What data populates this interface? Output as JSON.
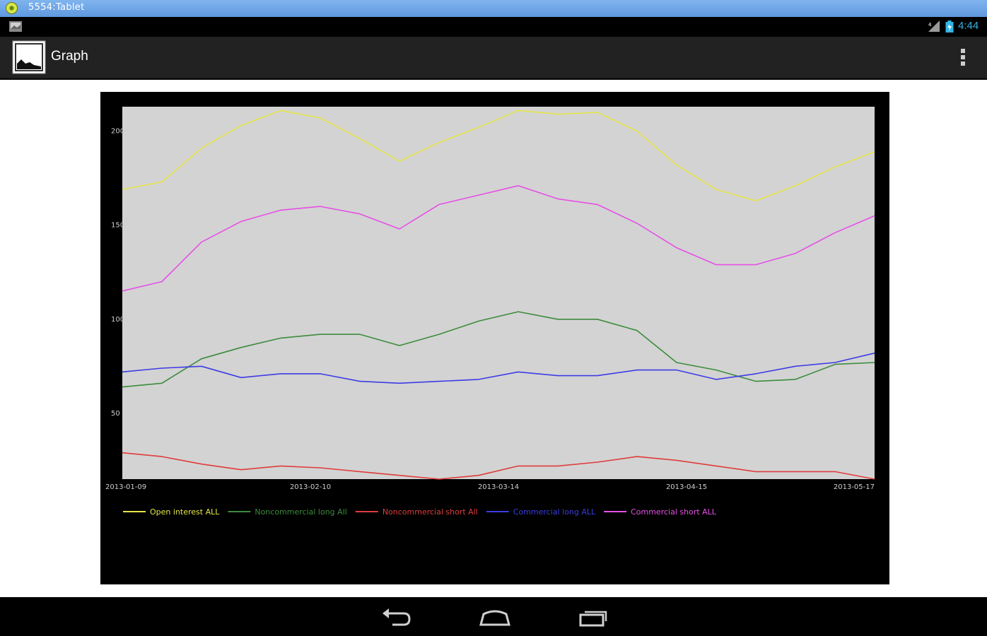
{
  "window": {
    "title": "5554:Tablet"
  },
  "status_bar": {
    "time": "4:44",
    "icons": [
      "notification-image-icon",
      "signal-icon",
      "battery-icon"
    ]
  },
  "action_bar": {
    "title": "Graph",
    "app_icon": "graph-app-icon",
    "menu_icon": "overflow-menu-icon"
  },
  "nav_bar": {
    "icons": [
      "back-icon",
      "home-icon",
      "recents-icon"
    ]
  },
  "colors": {
    "plot_background": "#d3d3d3",
    "chart_background": "#000000",
    "status_time": "#33b5e5"
  },
  "chart_data": {
    "type": "line",
    "title": "",
    "xlabel": "",
    "ylabel": "",
    "x": [
      "2013-01-09",
      "2013-01-15",
      "2013-01-22",
      "2013-01-29",
      "2013-02-05",
      "2013-02-12",
      "2013-02-19",
      "2013-02-26",
      "2013-03-05",
      "2013-03-12",
      "2013-03-19",
      "2013-03-26",
      "2013-04-02",
      "2013-04-09",
      "2013-04-16",
      "2013-04-23",
      "2013-04-30",
      "2013-05-07",
      "2013-05-14",
      "2013-05-17"
    ],
    "x_tick_labels": [
      "2013-01-09",
      "2013-02-10",
      "2013-03-14",
      "2013-04-15",
      "2013-05-17"
    ],
    "y_ticks": [
      50,
      100,
      150,
      200
    ],
    "y_tick_labels": [
      "50",
      "100",
      "150",
      "200"
    ],
    "ylim": [
      15,
      213
    ],
    "grid": false,
    "legend_position": "bottom",
    "series": [
      {
        "name": "Open interest ALL",
        "color": "#e6e64a",
        "values": [
          169,
          173,
          191,
          203,
          211,
          207,
          196,
          184,
          194,
          202,
          211,
          209,
          210,
          200,
          182,
          169,
          163,
          171,
          181,
          189
        ]
      },
      {
        "name": "Noncommercial long All",
        "color": "#3c8c3c",
        "values": [
          64,
          66,
          79,
          85,
          90,
          92,
          92,
          86,
          92,
          99,
          104,
          100,
          100,
          94,
          77,
          73,
          67,
          68,
          76,
          77
        ]
      },
      {
        "name": "Noncommercial short All",
        "color": "#e03c3c",
        "values": [
          29,
          27,
          23,
          20,
          22,
          21,
          19,
          17,
          15,
          17,
          22,
          22,
          24,
          27,
          25,
          22,
          19,
          19,
          19,
          15
        ]
      },
      {
        "name": "Commercial long ALL",
        "color": "#3c3ce6",
        "values": [
          72,
          74,
          75,
          69,
          71,
          71,
          67,
          66,
          67,
          68,
          72,
          70,
          70,
          73,
          73,
          68,
          71,
          75,
          77,
          82
        ]
      },
      {
        "name": "Commercial short ALL",
        "color": "#e650e6",
        "values": [
          115,
          120,
          141,
          152,
          158,
          160,
          156,
          148,
          161,
          166,
          171,
          164,
          161,
          151,
          138,
          129,
          129,
          135,
          146,
          155
        ]
      }
    ]
  }
}
